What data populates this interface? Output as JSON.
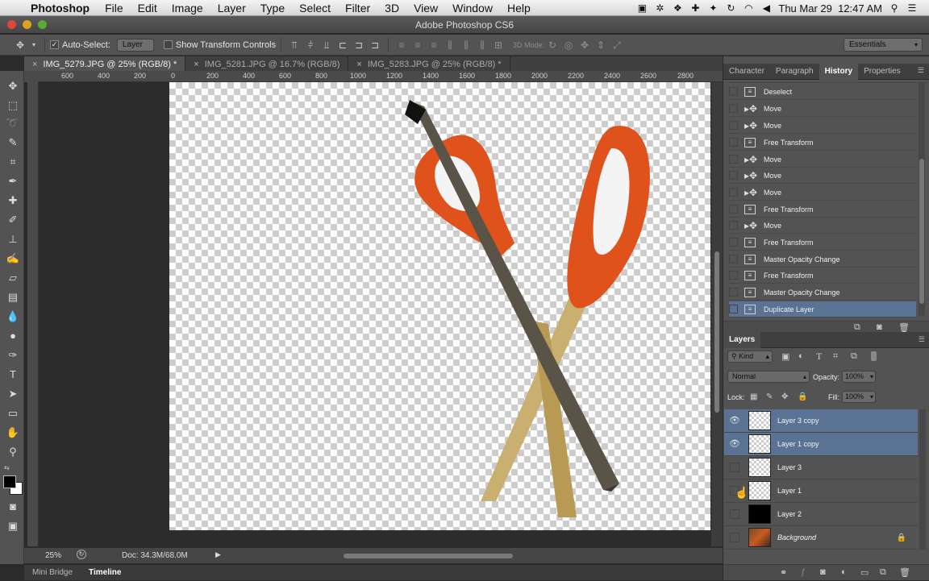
{
  "menubar": {
    "app_name": "Photoshop",
    "items": [
      "File",
      "Edit",
      "Image",
      "Layer",
      "Type",
      "Select",
      "Filter",
      "3D",
      "View",
      "Window",
      "Help"
    ],
    "clock": "Thu Mar 29  12:47 AM"
  },
  "window": {
    "title": "Adobe Photoshop CS6"
  },
  "options_bar": {
    "auto_select_label": "Auto-Select:",
    "auto_select_value": "Layer",
    "show_transform_label": "Show Transform Controls",
    "mode_3d_label": "3D Mode:",
    "workspace": "Essentials"
  },
  "doc_tabs": [
    {
      "label": "IMG_5279.JPG @ 25% (RGB/8) *"
    },
    {
      "label": "IMG_5281.JPG @ 16.7% (RGB/8)"
    },
    {
      "label": "IMG_5283.JPG @ 25% (RGB/8) *"
    }
  ],
  "ruler": {
    "h_labels": [
      "600",
      "400",
      "200",
      "0",
      "200",
      "400",
      "600",
      "800",
      "1000",
      "1200",
      "1400",
      "1600",
      "1800",
      "2000",
      "2200",
      "2400",
      "2600",
      "2800"
    ]
  },
  "status": {
    "zoom": "25%",
    "doc_size": "Doc: 34.3M/68.0M"
  },
  "bottom_tabs": [
    "Mini Bridge",
    "Timeline"
  ],
  "history_panel": {
    "tabs": [
      "Character",
      "Paragraph",
      "History",
      "Properties"
    ],
    "active_tab": "History",
    "items": [
      {
        "label": "Deselect",
        "icon": "doc-icon"
      },
      {
        "label": "Move",
        "icon": "move-icon"
      },
      {
        "label": "Move",
        "icon": "move-icon"
      },
      {
        "label": "Free Transform",
        "icon": "doc-icon"
      },
      {
        "label": "Move",
        "icon": "move-icon"
      },
      {
        "label": "Move",
        "icon": "move-icon"
      },
      {
        "label": "Move",
        "icon": "move-icon"
      },
      {
        "label": "Free Transform",
        "icon": "doc-icon"
      },
      {
        "label": "Move",
        "icon": "move-icon"
      },
      {
        "label": "Free Transform",
        "icon": "doc-icon"
      },
      {
        "label": "Master Opacity Change",
        "icon": "doc-icon"
      },
      {
        "label": "Free Transform",
        "icon": "doc-icon"
      },
      {
        "label": "Master Opacity Change",
        "icon": "doc-icon"
      },
      {
        "label": "Duplicate Layer",
        "icon": "doc-icon",
        "selected": true
      }
    ]
  },
  "layers_panel": {
    "title": "Layers",
    "kind_label": "Kind",
    "blend_mode": "Normal",
    "opacity_label": "Opacity:",
    "opacity": "100%",
    "lock_label": "Lock:",
    "fill_label": "Fill:",
    "fill": "100%",
    "layers": [
      {
        "name": "Layer 3 copy",
        "visible": true,
        "selected": true,
        "thumb": "transparent"
      },
      {
        "name": "Layer 1 copy",
        "visible": true,
        "selected": true,
        "thumb": "transparent"
      },
      {
        "name": "Layer 3",
        "visible": false,
        "selected": false,
        "thumb": "transparent"
      },
      {
        "name": "Layer 1",
        "visible": false,
        "selected": false,
        "thumb": "transparent"
      },
      {
        "name": "Layer 2",
        "visible": false,
        "selected": false,
        "thumb": "black"
      },
      {
        "name": "Background",
        "visible": false,
        "selected": false,
        "thumb": "photo",
        "locked": true
      }
    ]
  },
  "colors": {
    "accent_selection": "#5a7395",
    "scissors_orange": "#e0521c"
  }
}
